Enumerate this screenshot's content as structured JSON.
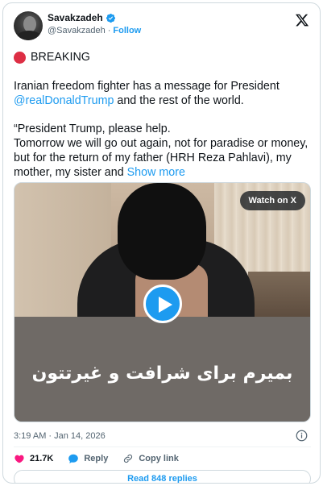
{
  "author": {
    "name": "Savakzadeh",
    "handle": "@Savakzadeh",
    "separator": "·",
    "follow_label": "Follow"
  },
  "tweet": {
    "breaking": "BREAKING",
    "line1": "Iranian freedom fighter has a message for President",
    "mention": "@realDonaldTrump",
    "line2_rest": " and the rest of the world.",
    "line3": "“President Trump, please help.",
    "line4": "Tomorrow we will go out again, not for paradise or money,",
    "line5": "but for the return of my father (HRH Reza Pahlavi), my",
    "line6": "mother, my sister and ",
    "show_more": "Show more"
  },
  "video": {
    "watch_label": "Watch on X",
    "caption": "بمیرم برای شرافت و غیرتتون"
  },
  "timestamp": "3:19 AM · Jan 14, 2026",
  "actions": {
    "likes": "21.7K",
    "reply_label": "Reply",
    "copy_link_label": "Copy link"
  },
  "read_replies_label": "Read 848 replies",
  "colors": {
    "accent": "#1d9bf0",
    "like": "#f91880",
    "breaking_dot": "#dd2e44"
  },
  "icons": [
    "verified-badge-icon",
    "x-logo-icon",
    "play-icon",
    "info-icon",
    "heart-icon",
    "reply-bubble-icon",
    "link-icon"
  ]
}
